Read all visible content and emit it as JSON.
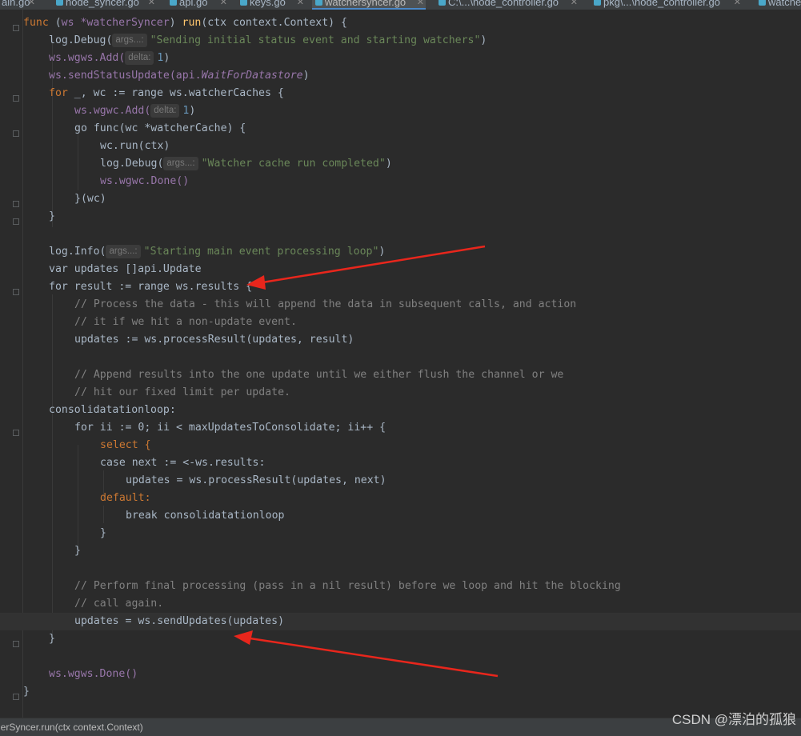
{
  "tabs": [
    {
      "label": "ain.go",
      "active": false
    },
    {
      "label": "node_syncer.go",
      "active": false
    },
    {
      "label": "api.go",
      "active": false
    },
    {
      "label": "keys.go",
      "active": false
    },
    {
      "label": "watchersyncer.go",
      "active": true
    },
    {
      "label": "C:\\...\\node_controller.go",
      "active": false
    },
    {
      "label": "pkg\\...\\node_controller.go",
      "active": false
    },
    {
      "label": "watche",
      "active": false
    }
  ],
  "code": {
    "l1_kw": "func",
    "l1_recv": "ws *watcherSyncer",
    "l1_fn": "run",
    "l1_sig": "(ctx context.Context) {",
    "l2_call": "log.Debug(",
    "l2_hint": "args...:",
    "l2_str": "\"Sending initial status event and starting watchers\"",
    "l3_pre": "ws.wgws.Add(",
    "l3_hint": "delta:",
    "l3_num": "1",
    "l4_pre": "ws.sendStatusUpdate(api.",
    "l4_const": "WaitForDatastore",
    "l5_text": "_, wc := range ws.watcherCaches {",
    "l6_pre": "ws.wgwc.Add(",
    "l6_hint": "delta:",
    "l6_num": "1",
    "l7_text": "go func(wc *watcherCache) {",
    "l8_text": "wc.run(ctx)",
    "l9_call": "log.Debug(",
    "l9_hint": "args...:",
    "l9_str": "\"Watcher cache run completed\"",
    "l10_text": "ws.wgwc.Done()",
    "l11_text": "}(wc)",
    "l12_text": "}",
    "l14_call": "log.Info(",
    "l14_hint": "args...:",
    "l14_str": "\"Starting main event processing loop\"",
    "l15_text": "var updates []api.Update",
    "l16_text": "for result := range ws.results {",
    "l17_cm": "// Process the data - this will append the data in subsequent calls, and action",
    "l18_cm": "// it if we hit a non-update event.",
    "l19_text": "updates := ws.processResult(updates, result)",
    "l21_cm": "// Append results into the one update until we either flush the channel or we",
    "l22_cm": "// hit our fixed limit per update.",
    "l23_text": "consolidatationloop:",
    "l24_text": "for ii := 0; ii < maxUpdatesToConsolidate; ii++ {",
    "l25_text": "select {",
    "l26_text": "case next := <-ws.results:",
    "l27_text": "updates = ws.processResult(updates, next)",
    "l28_text": "default:",
    "l29_text": "break consolidatationloop",
    "l30_text": "}",
    "l31_text": "}",
    "l33_cm": "// Perform final processing (pass in a nil result) before we loop and hit the blocking",
    "l34_cm": "// call again.",
    "l35_text": "updates = ws.sendUpdates(updates)",
    "l36_text": "}",
    "l38_text": "ws.wgws.Done()",
    "l39_text": "}"
  },
  "status": {
    "breadcrumb": "herSyncer.run(ctx context.Context)"
  },
  "watermark": "CSDN @漂泊的孤狼",
  "colors": {
    "background": "#2b2b2b",
    "keyword": "#cc7832",
    "string": "#6a8759",
    "arrow": "#e8261c"
  }
}
